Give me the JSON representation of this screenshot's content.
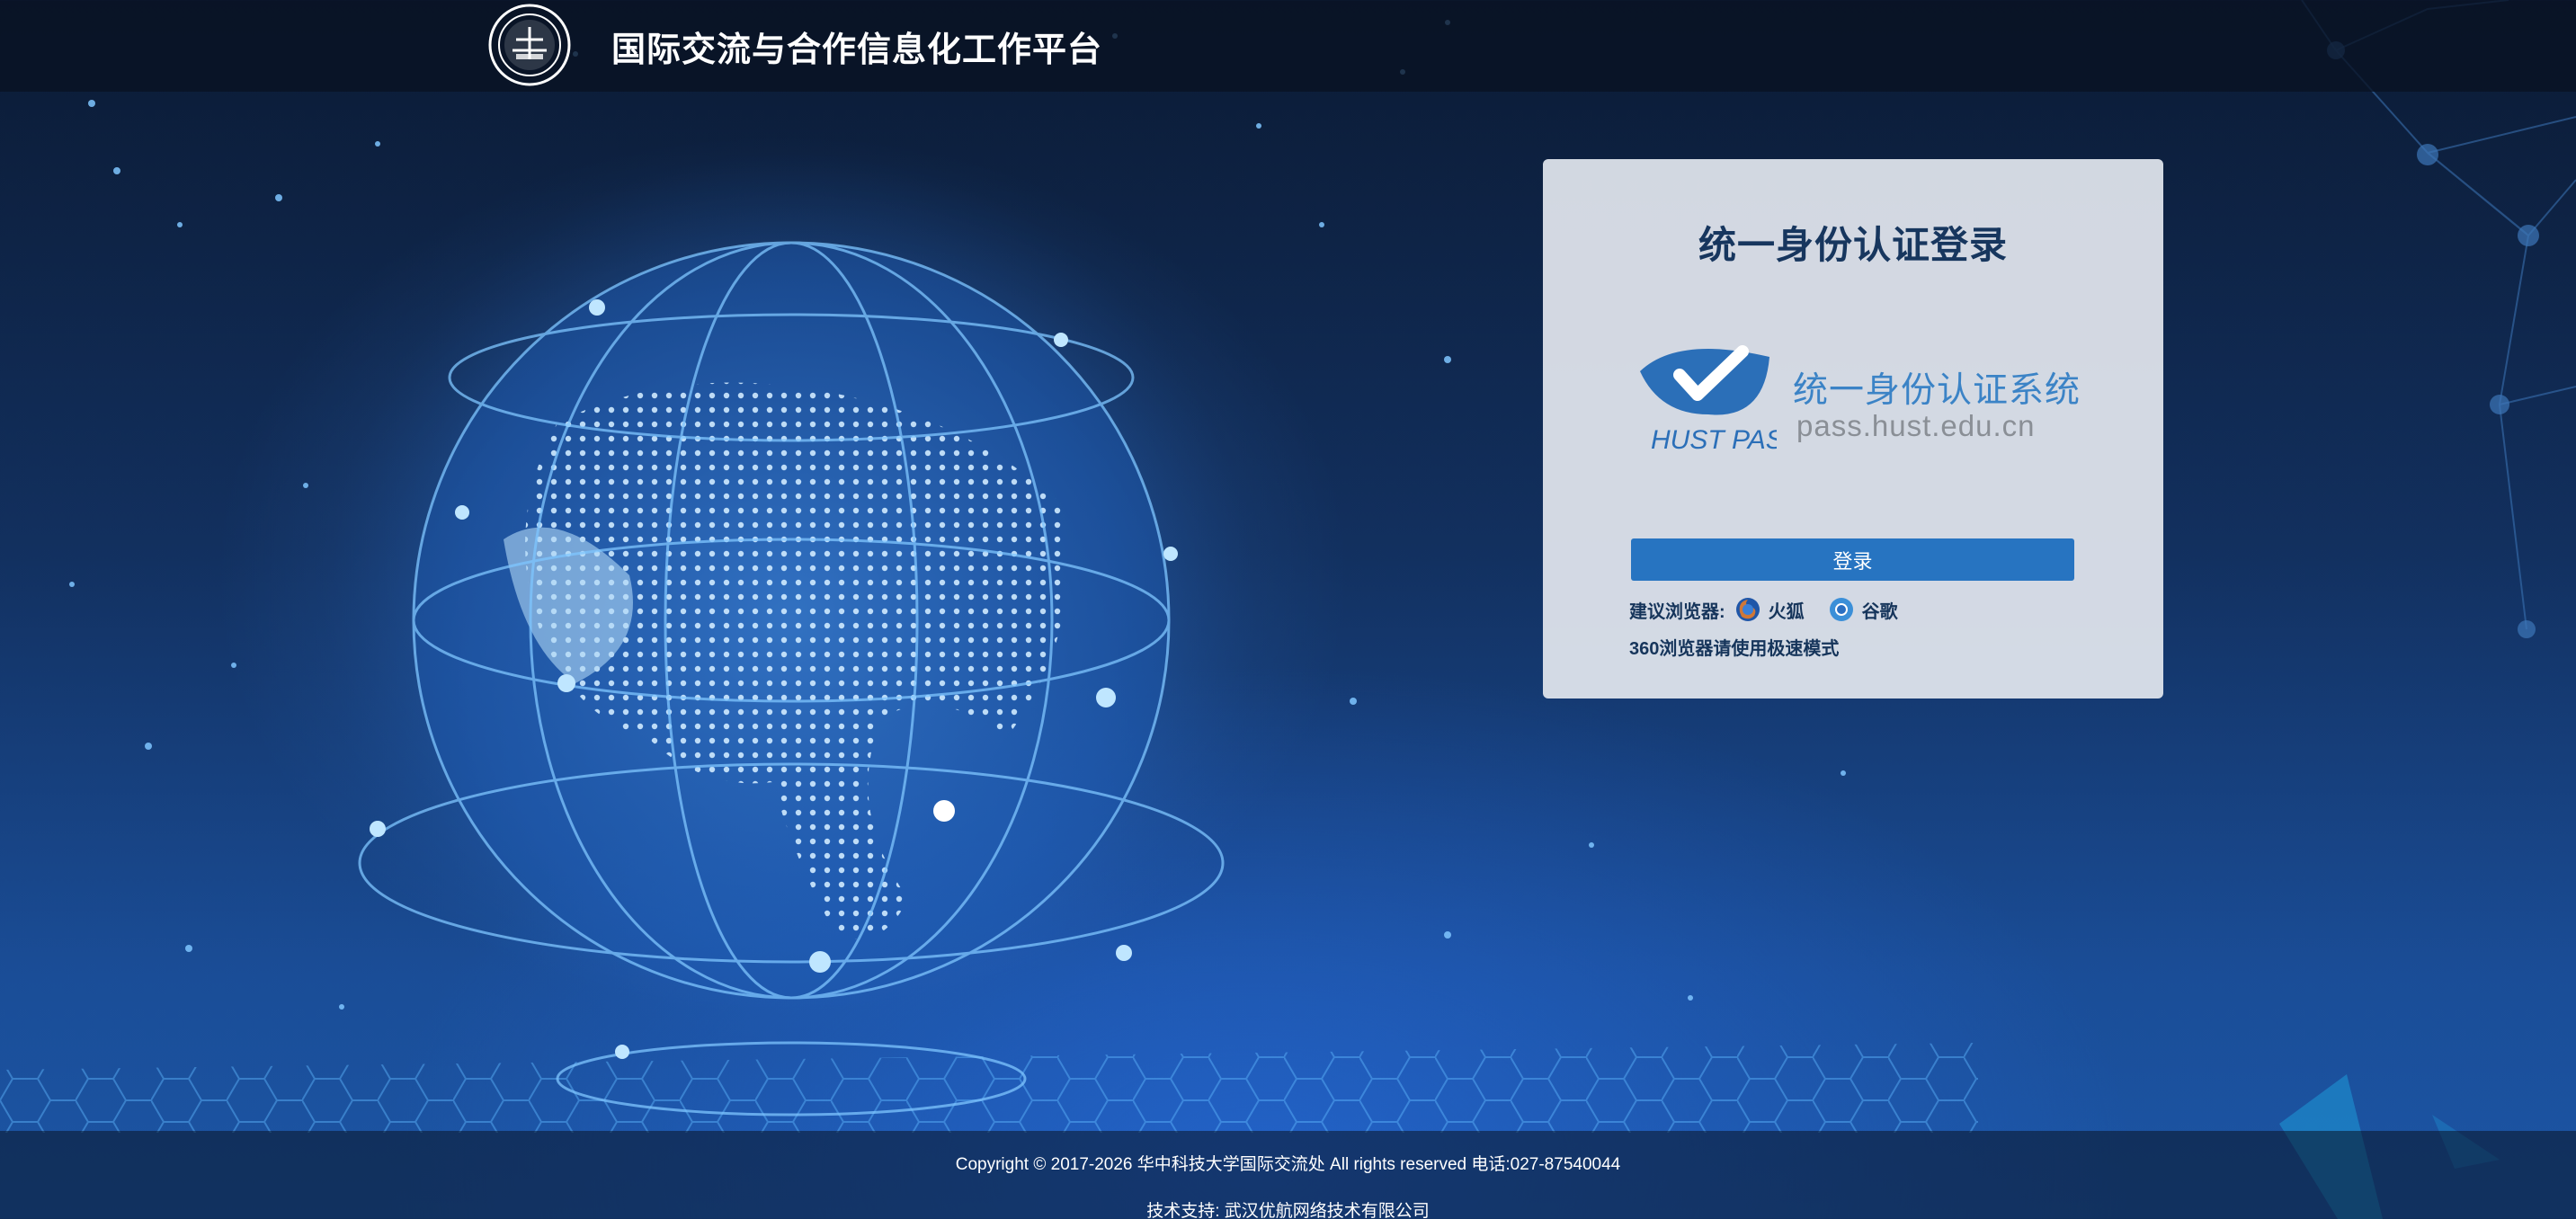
{
  "header": {
    "site_title": "国际交流与合作信息化工作平台",
    "logo": "hust-university-seal"
  },
  "login": {
    "heading": "统一身份认证登录",
    "system_logo_text": "HUST PASS",
    "system_name": "统一身份认证系统",
    "system_domain": "pass.hust.edu.cn",
    "button_label": "登录",
    "browser_label": "建议浏览器:",
    "browsers": [
      {
        "name": "火狐",
        "icon": "firefox-icon"
      },
      {
        "name": "谷歌",
        "icon": "chrome-icon"
      }
    ],
    "browser_note": "360浏览器请使用极速模式"
  },
  "footer": {
    "copyright": "Copyright © 2017-2026 华中科技大学国际交流处 All rights reserved 电话:027-87540044",
    "tech_support": "技术支持: 武汉优航网络技术有限公司"
  },
  "colors": {
    "header_bg": "#091222",
    "card_bg": "#e2e6ee",
    "primary_button": "#2774c1",
    "heading_text": "#17365e",
    "system_name_text": "#3b83c6"
  }
}
